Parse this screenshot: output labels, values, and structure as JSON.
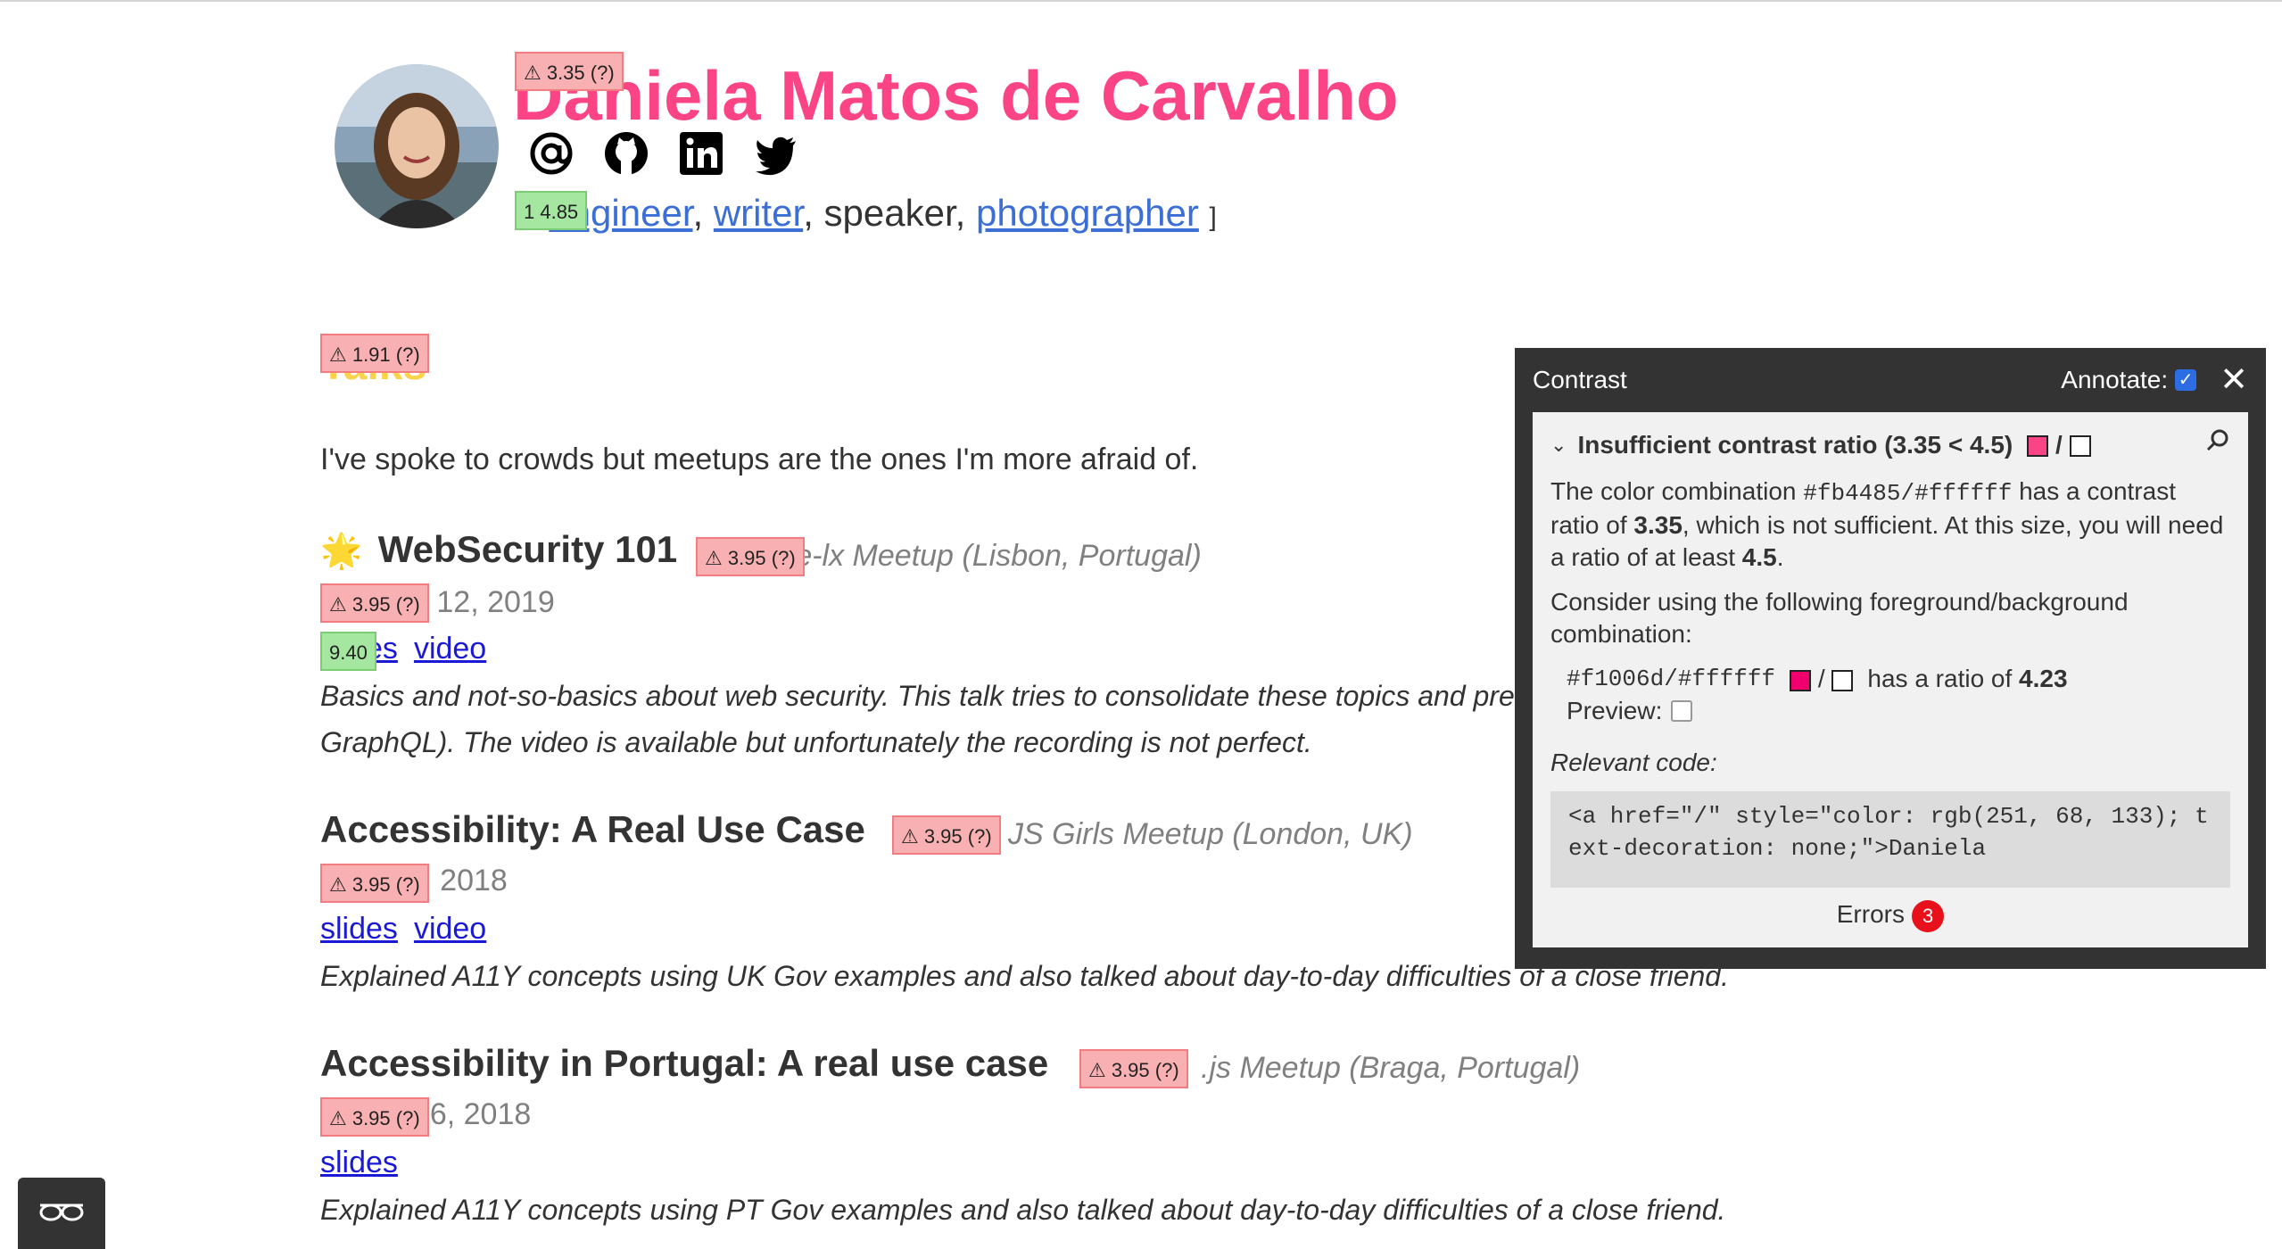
{
  "header": {
    "name": "Daniela Matos de Carvalho",
    "roles_prefix": "[",
    "roles": [
      "engineer",
      "writer",
      "speaker",
      "photographer"
    ],
    "roles_suffix": "]"
  },
  "social_icons": [
    "at-icon",
    "github-icon",
    "linkedin-icon",
    "twitter-icon"
  ],
  "section": {
    "heading": "Talks",
    "intro": "I've spoke to crowds but meetups are the ones I'm more afraid of."
  },
  "talks": [
    {
      "emoji": "🌟",
      "title": "WebSecurity 101",
      "venue": "re-lx Meetup (Lisbon, Portugal)",
      "date": "October 12, 2019",
      "links": [
        "slides",
        "video"
      ],
      "desc_line1": "Basics and not-so-basics about web security. This talk tries to consolidate these topics and prese",
      "desc_line2": "GraphQL). The video is available but unfortunately the recording is not perfect."
    },
    {
      "title": "Accessibility: A Real Use Case",
      "venue": "JS Girls Meetup (London, UK)",
      "date": "April 23, 2018",
      "links": [
        "slides",
        "video"
      ],
      "desc_line1": "Explained A11Y concepts using UK Gov examples and also talked about day-to-day difficulties of a close friend."
    },
    {
      "title": "Accessibility in Portugal: A real use case",
      "venue": ".js Meetup (Braga, Portugal)",
      "date": "March 16, 2018",
      "links": [
        "slides"
      ],
      "desc_line1": "Explained A11Y concepts using PT Gov examples and also talked about day-to-day difficulties of a close friend."
    }
  ],
  "badges": {
    "name": "⚠ 3.35 (?)",
    "roles": "1 4.85",
    "heading": "⚠ 1.91 (?)",
    "t1_venue": "⚠ 3.95 (?)",
    "t1_date": "⚠ 3.95 (?)",
    "t1_links": "9.40",
    "t2_venue": "⚠ 3.95 (?)",
    "t2_date": "⚠ 3.95 (?)",
    "t3_venue": "⚠ 3.95 (?)",
    "t3_date": "⚠ 3.95 (?)"
  },
  "panel": {
    "title": "Contrast",
    "annotate_label": "Annotate:",
    "issue_title": "Insufficient contrast ratio (3.35 < 4.5)",
    "text_1a": "The color combination ",
    "text_1_code": "#fb4485/#ffffff",
    "text_1b": " has a contrast ratio of ",
    "text_1_ratio": "3.35",
    "text_1c": ", which is not sufficient. At this size, you will need a ratio of at least ",
    "text_1_min": "4.5",
    "text_1d": ".",
    "text_2": "Consider using the following foreground/background combination:",
    "suggest_code": "#f1006d/#ffffff",
    "suggest_text": "has a ratio of",
    "suggest_ratio": "4.23",
    "preview_label": "Preview:",
    "relevant_label": "Relevant code:",
    "code": "<a href=\"/\" style=\"color: rgb(251, 68, 133); text-decoration: none;\">Daniela",
    "errors_label": "Errors",
    "errors_count": "3"
  },
  "colors": {
    "accent": "#fb4485",
    "suggested": "#f1006d",
    "link": "#3b6fd6",
    "panel_bg": "#333333",
    "error_red": "#e8101a"
  }
}
